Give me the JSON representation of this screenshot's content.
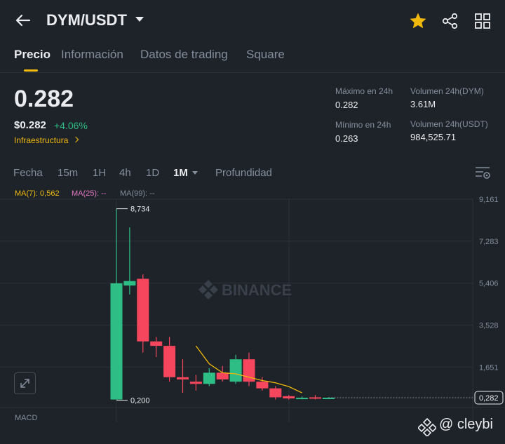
{
  "header": {
    "pair": "DYM/USDT",
    "icons": [
      "back-arrow-icon",
      "star-icon",
      "share-icon",
      "grid-icon"
    ],
    "star_color": "#f0b90b"
  },
  "tabs": [
    {
      "label": "Precio",
      "active": true
    },
    {
      "label": "Información",
      "active": false
    },
    {
      "label": "Datos de trading",
      "active": false
    },
    {
      "label": "Square",
      "active": false
    }
  ],
  "ticker": {
    "price": "0.282",
    "price_usd": "$0.282",
    "change": "+4.06%",
    "category": "Infraestructura"
  },
  "stats": {
    "high_label": "Máximo en 24h",
    "high_value": "0.282",
    "low_label": "Mínimo en 24h",
    "low_value": "0.263",
    "vol_base_label": "Volumen 24h(DYM)",
    "vol_base_value": "3.61M",
    "vol_quote_label": "Volumen 24h(USDT)",
    "vol_quote_value": "984,525.71"
  },
  "intervals": [
    {
      "label": "Fecha",
      "active": false
    },
    {
      "label": "15m",
      "active": false
    },
    {
      "label": "1H",
      "active": false
    },
    {
      "label": "4h",
      "active": false
    },
    {
      "label": "1D",
      "active": false
    },
    {
      "label": "1M",
      "active": true
    },
    {
      "label": "Profundidad",
      "active": false
    }
  ],
  "ma": {
    "ma7": "MA(7): 0,562",
    "ma25": "MA(25): --",
    "ma99": "MA(99): --",
    "ma7_color": "#f0b90b",
    "ma25_color": "#e377c2",
    "ma99_color": "#848e9c"
  },
  "chart": {
    "watermark": "BINANCE",
    "y_ticks": [
      "9,161",
      "7,283",
      "5,406",
      "3,528",
      "1,651"
    ],
    "current_price_label": "0,282",
    "max_label": "8,734",
    "min_label": "0,200",
    "indicator": "MACD",
    "up_color": "#2ebd85",
    "down_color": "#f6465d"
  },
  "chart_data": {
    "type": "candlestick",
    "y_ticks": [
      9.161,
      7.283,
      5.406,
      3.528,
      1.651
    ],
    "ylim": [
      0.2,
      9.4
    ],
    "candles": [
      {
        "open": 0.2,
        "close": 5.4,
        "high": 8.734,
        "low": 0.2
      },
      {
        "open": 5.3,
        "close": 5.5,
        "high": 7.9,
        "low": 4.9
      },
      {
        "open": 5.6,
        "close": 2.8,
        "high": 5.8,
        "low": 2.3
      },
      {
        "open": 2.8,
        "close": 2.6,
        "high": 3.0,
        "low": 2.1
      },
      {
        "open": 2.6,
        "close": 1.2,
        "high": 3.0,
        "low": 1.0
      },
      {
        "open": 1.2,
        "close": 1.1,
        "high": 2.0,
        "low": 0.5
      },
      {
        "open": 1.0,
        "close": 0.9,
        "high": 1.3,
        "low": 0.6
      },
      {
        "open": 0.9,
        "close": 1.4,
        "high": 1.6,
        "low": 0.8
      },
      {
        "open": 1.4,
        "close": 1.1,
        "high": 1.7,
        "low": 1.0
      },
      {
        "open": 1.0,
        "close": 2.0,
        "high": 2.2,
        "low": 0.9
      },
      {
        "open": 2.0,
        "close": 1.0,
        "high": 2.3,
        "low": 0.8
      },
      {
        "open": 1.0,
        "close": 0.7,
        "high": 1.2,
        "low": 0.6
      },
      {
        "open": 0.7,
        "close": 0.3,
        "high": 0.8,
        "low": 0.2
      },
      {
        "open": 0.35,
        "close": 0.25,
        "high": 0.4,
        "low": 0.2
      },
      {
        "open": 0.25,
        "close": 0.28,
        "high": 0.34,
        "low": 0.21
      },
      {
        "open": 0.3,
        "close": 0.27,
        "high": 0.4,
        "low": 0.2
      },
      {
        "open": 0.27,
        "close": 0.282,
        "high": 0.3,
        "low": 0.26
      }
    ],
    "ma7": [
      null,
      null,
      null,
      null,
      null,
      null,
      2.6,
      1.8,
      1.4,
      1.35,
      1.2,
      1.05,
      0.95,
      0.78,
      0.5,
      null,
      null
    ]
  },
  "watermark_user": "@ cleybi"
}
